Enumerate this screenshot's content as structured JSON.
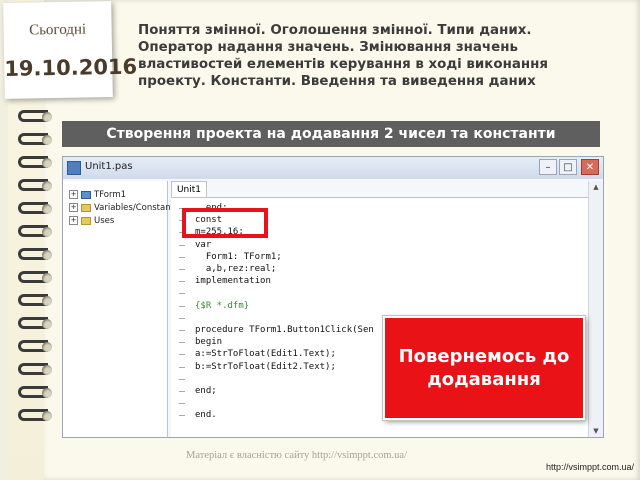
{
  "header": {
    "today_label": "Сьогодні",
    "date": "19.10.2016",
    "title": "Поняття змінної. Оголошення змінної. Типи даних. Оператор надання значень. Змінювання значень властивостей елементів керування в ході виконання проекту. Константи. Введення та виведення даних"
  },
  "banner": {
    "text": "Створення проекта на додавання 2 чисел та константи"
  },
  "ide": {
    "window_title": "Unit1.pas",
    "window_buttons": {
      "minimize": "–",
      "maximize": "□",
      "close": "✕"
    },
    "tree_items": [
      {
        "label": "TForm1"
      },
      {
        "label": "Variables/Constants"
      },
      {
        "label": "Uses"
      }
    ],
    "tab_label": "Unit1",
    "code_lines": [
      "  end;",
      "const",
      "m=255.16;",
      "var",
      "  Form1: TForm1;",
      "  a,b,rez:real;",
      "implementation",
      "",
      "{$R *.dfm}",
      "",
      "procedure TForm1.Button1Click(Sen",
      "begin",
      "a:=StrToFloat(Edit1.Text);",
      "b:=StrToFloat(Edit2.Text);",
      "",
      "end;",
      "",
      "end."
    ],
    "scroll_up": "▲",
    "scroll_down": "▼"
  },
  "callout": {
    "text": "Повернемось до додавання"
  },
  "footer": {
    "note": "Матеріал є власністю сайту http://vsimppt.com.ua/",
    "url": "http://vsimppt.com.ua/"
  },
  "colors": {
    "accent_red": "#e81217",
    "banner_bg": "#5f5f5f",
    "text_dark": "#3b3b3b"
  }
}
